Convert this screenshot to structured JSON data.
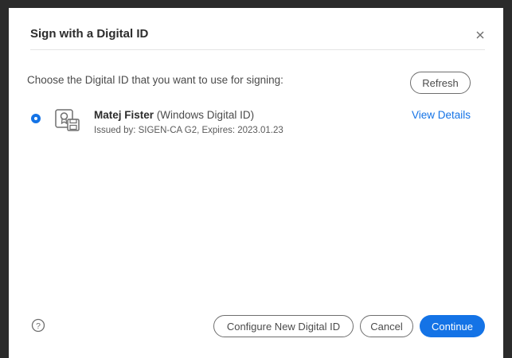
{
  "dialog": {
    "title": "Sign with a Digital ID",
    "close_icon": "close-icon"
  },
  "instruction": "Choose the Digital ID that you want to use for signing:",
  "refresh_label": "Refresh",
  "digital_ids": [
    {
      "selected": true,
      "icon": "certificate-id-icon",
      "name": "Matej Fister",
      "type": "(Windows Digital ID)",
      "issued": "Issued by: SIGEN-CA G2, Expires: 2023.01.23",
      "details_label": "View Details"
    }
  ],
  "footer": {
    "help_icon": "help-icon",
    "configure_label": "Configure New Digital ID",
    "cancel_label": "Cancel",
    "continue_label": "Continue"
  },
  "colors": {
    "accent": "#1473e6",
    "title_text": "#2c2c2c",
    "body_text": "#4b4b4b",
    "background": "#2b2b2b"
  }
}
